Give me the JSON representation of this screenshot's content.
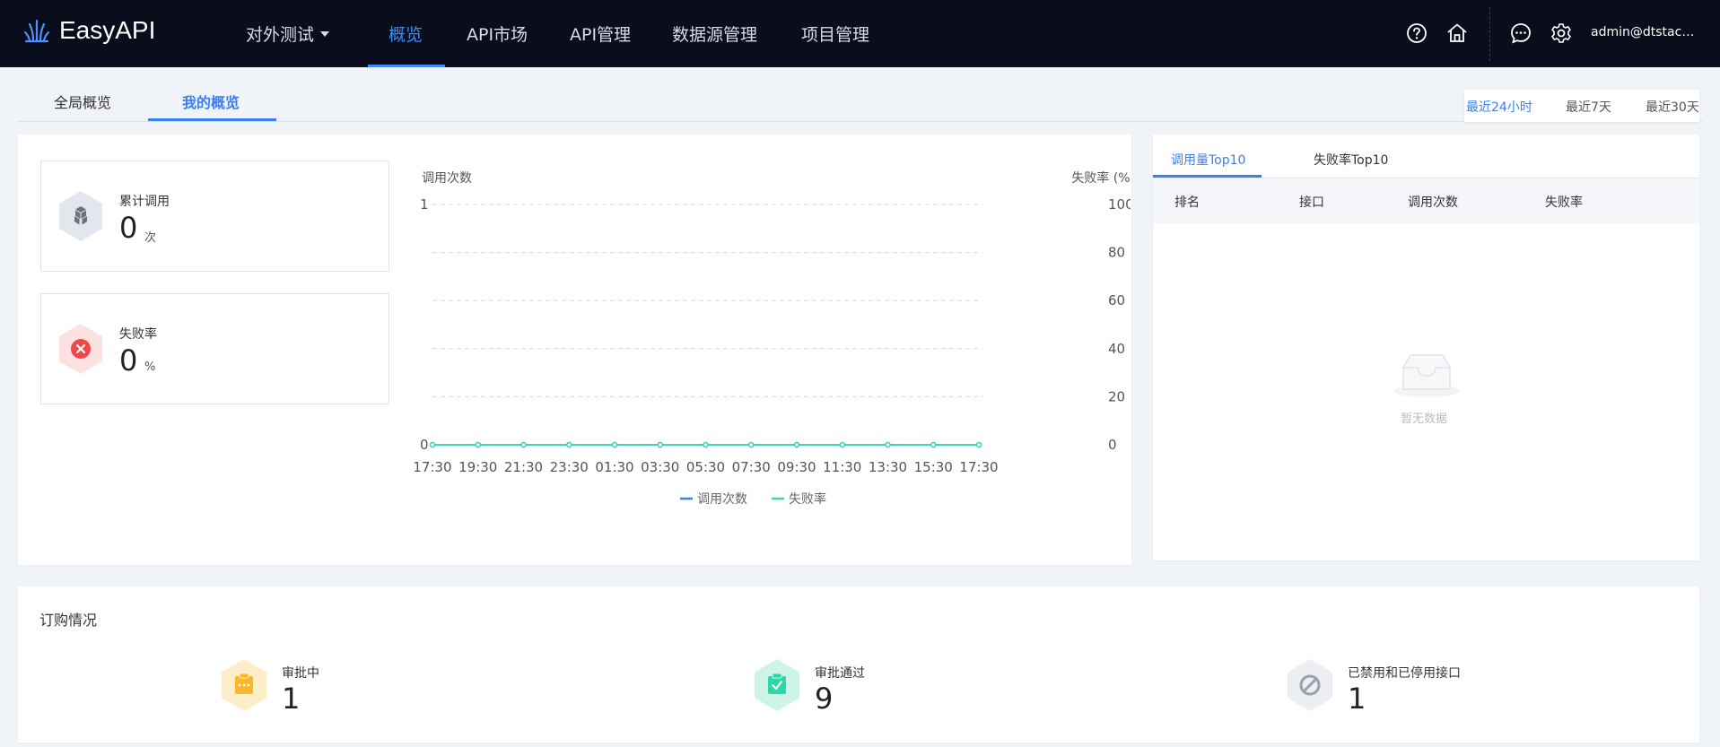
{
  "app": {
    "name": "EasyAPI"
  },
  "nav": {
    "project_dropdown": "对外测试",
    "items": [
      "概览",
      "API市场",
      "API管理",
      "数据源管理",
      "项目管理"
    ],
    "active": "概览"
  },
  "toolbar": {
    "icons": [
      "help-icon",
      "home-icon",
      "message-icon",
      "settings-icon"
    ],
    "user": "admin@dtstack.com"
  },
  "subtabs": {
    "items": [
      "全局概览",
      "我的概览"
    ],
    "active": "我的概览"
  },
  "time_range": {
    "options": [
      "最近24小时",
      "最近7天",
      "最近30天"
    ],
    "active": "最近24小时"
  },
  "stats": {
    "calls": {
      "label": "累计调用",
      "value": "0",
      "unit": "次"
    },
    "failure": {
      "label": "失败率",
      "value": "0",
      "unit": "%"
    }
  },
  "chart_data": {
    "type": "line",
    "ylabel_left": "调用次数",
    "ylabel_right": "失败率 (%)",
    "x": [
      "17:30",
      "19:30",
      "21:30",
      "23:30",
      "01:30",
      "03:30",
      "05:30",
      "07:30",
      "09:30",
      "11:30",
      "13:30",
      "15:30",
      "17:30"
    ],
    "y_left_ticks": [
      "1",
      "0"
    ],
    "y_right_ticks": [
      "100",
      "80",
      "60",
      "40",
      "20",
      "0"
    ],
    "ylim_left": [
      0,
      1
    ],
    "ylim_right": [
      0,
      100
    ],
    "series": [
      {
        "name": "调用次数",
        "axis": "left",
        "color": "#3a7ff3",
        "values": [
          0,
          0,
          0,
          0,
          0,
          0,
          0,
          0,
          0,
          0,
          0,
          0,
          0
        ]
      },
      {
        "name": "失败率",
        "axis": "right",
        "color": "#3fd3b8",
        "values": [
          0,
          0,
          0,
          0,
          0,
          0,
          0,
          0,
          0,
          0,
          0,
          0,
          0
        ]
      }
    ],
    "grid": true,
    "legend": "bottom-center"
  },
  "top10": {
    "tabs": [
      "调用量Top10",
      "失败率Top10"
    ],
    "active": "调用量Top10",
    "columns": [
      "排名",
      "接口",
      "调用次数",
      "失败率"
    ],
    "rows": [],
    "empty_text": "暂无数据"
  },
  "subscription": {
    "title": "订购情况",
    "items": [
      {
        "label": "审批中",
        "value": "1",
        "color": "#f9b729"
      },
      {
        "label": "审批通过",
        "value": "9",
        "color": "#2dd8a8"
      },
      {
        "label": "已禁用和已停用接口",
        "value": "1",
        "color": "#9aa1ad"
      }
    ]
  }
}
